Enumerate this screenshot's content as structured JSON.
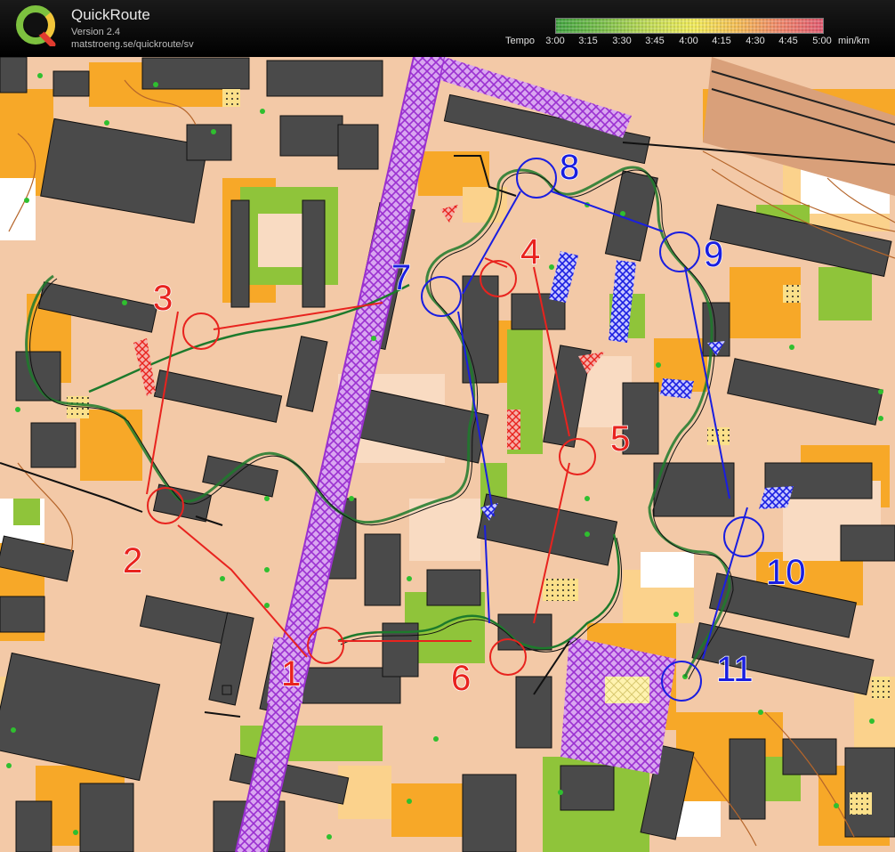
{
  "app": {
    "name": "QuickRoute",
    "version": "Version 2.4",
    "url": "matstroeng.se/quickroute/sv"
  },
  "tempo_scale": {
    "label": "Tempo",
    "ticks": [
      "3:00",
      "3:15",
      "3:30",
      "3:45",
      "4:00",
      "4:15",
      "4:30",
      "4:45",
      "5:00"
    ],
    "unit": "min/km"
  },
  "map": {
    "controls_red": [
      "1",
      "2",
      "3",
      "4",
      "5",
      "6"
    ],
    "controls_blue": [
      "7",
      "8",
      "9",
      "10",
      "11"
    ],
    "colors": {
      "red_course": "#e8231e",
      "blue_course": "#1a1ee0",
      "purple": "#b040e0",
      "open_land": "#f7a828",
      "rough_open": "#fbd28c",
      "paved": "#f3c9a7",
      "green": "#8fc43a",
      "building": "#4a4a4a"
    }
  }
}
